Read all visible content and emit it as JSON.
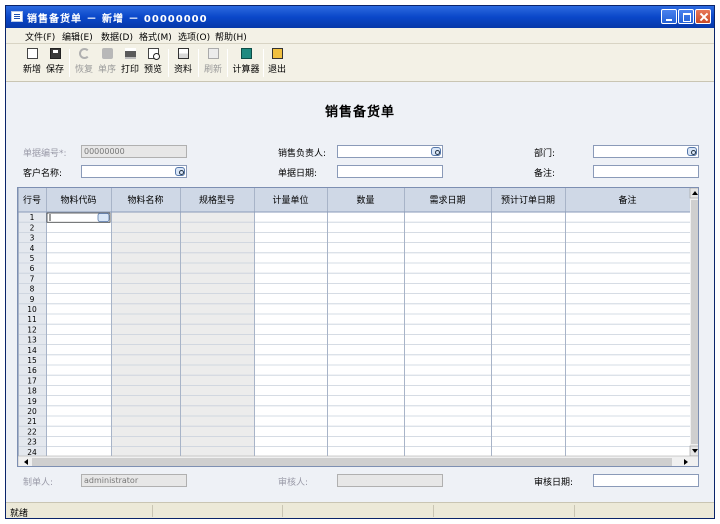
{
  "window": {
    "title": "销售备货单 － 新增 － 00000000"
  },
  "menu": [
    "文件(F)",
    "编辑(E)",
    "数据(D)",
    "格式(M)",
    "选项(O)",
    "帮助(H)"
  ],
  "toolbar": {
    "new": "新增",
    "save": "保存",
    "restore": "恢复",
    "sort": "单序",
    "print": "打印",
    "preview": "预览",
    "data": "资料",
    "refresh": "刷新",
    "calculator": "计算器",
    "exit": "退出"
  },
  "document": {
    "title": "销售备货单"
  },
  "header": {
    "doc_no_label": "单据编号*:",
    "doc_no_value": "00000000",
    "sales_rep_label": "销售负责人:",
    "sales_rep_value": "",
    "dept_label": "部门:",
    "dept_value": "",
    "customer_label": "客户名称:",
    "customer_value": "",
    "doc_date_label": "单据日期:",
    "doc_date_value": "",
    "remark_label": "备注:",
    "remark_value": ""
  },
  "grid": {
    "columns": [
      "行号",
      "物料代码",
      "物料名称",
      "规格型号",
      "计量单位",
      "数量",
      "需求日期",
      "预计订单日期",
      "备注"
    ],
    "rows": [
      "1",
      "2",
      "3",
      "4",
      "5",
      "6",
      "7",
      "8",
      "9",
      "10",
      "11",
      "12",
      "13",
      "14",
      "15",
      "16",
      "17",
      "18",
      "19",
      "20",
      "21",
      "22",
      "23",
      "24"
    ]
  },
  "footer": {
    "maker_label": "制单人:",
    "maker_value": "administrator",
    "auditor_label": "审核人:",
    "auditor_value": "",
    "audit_date_label": "审核日期:",
    "audit_date_value": ""
  },
  "status": {
    "text": "就绪"
  },
  "colors": {
    "titlebar": "#0a47c9",
    "grid_header": "#cfd8e6",
    "readonly_col": "#ececec"
  }
}
